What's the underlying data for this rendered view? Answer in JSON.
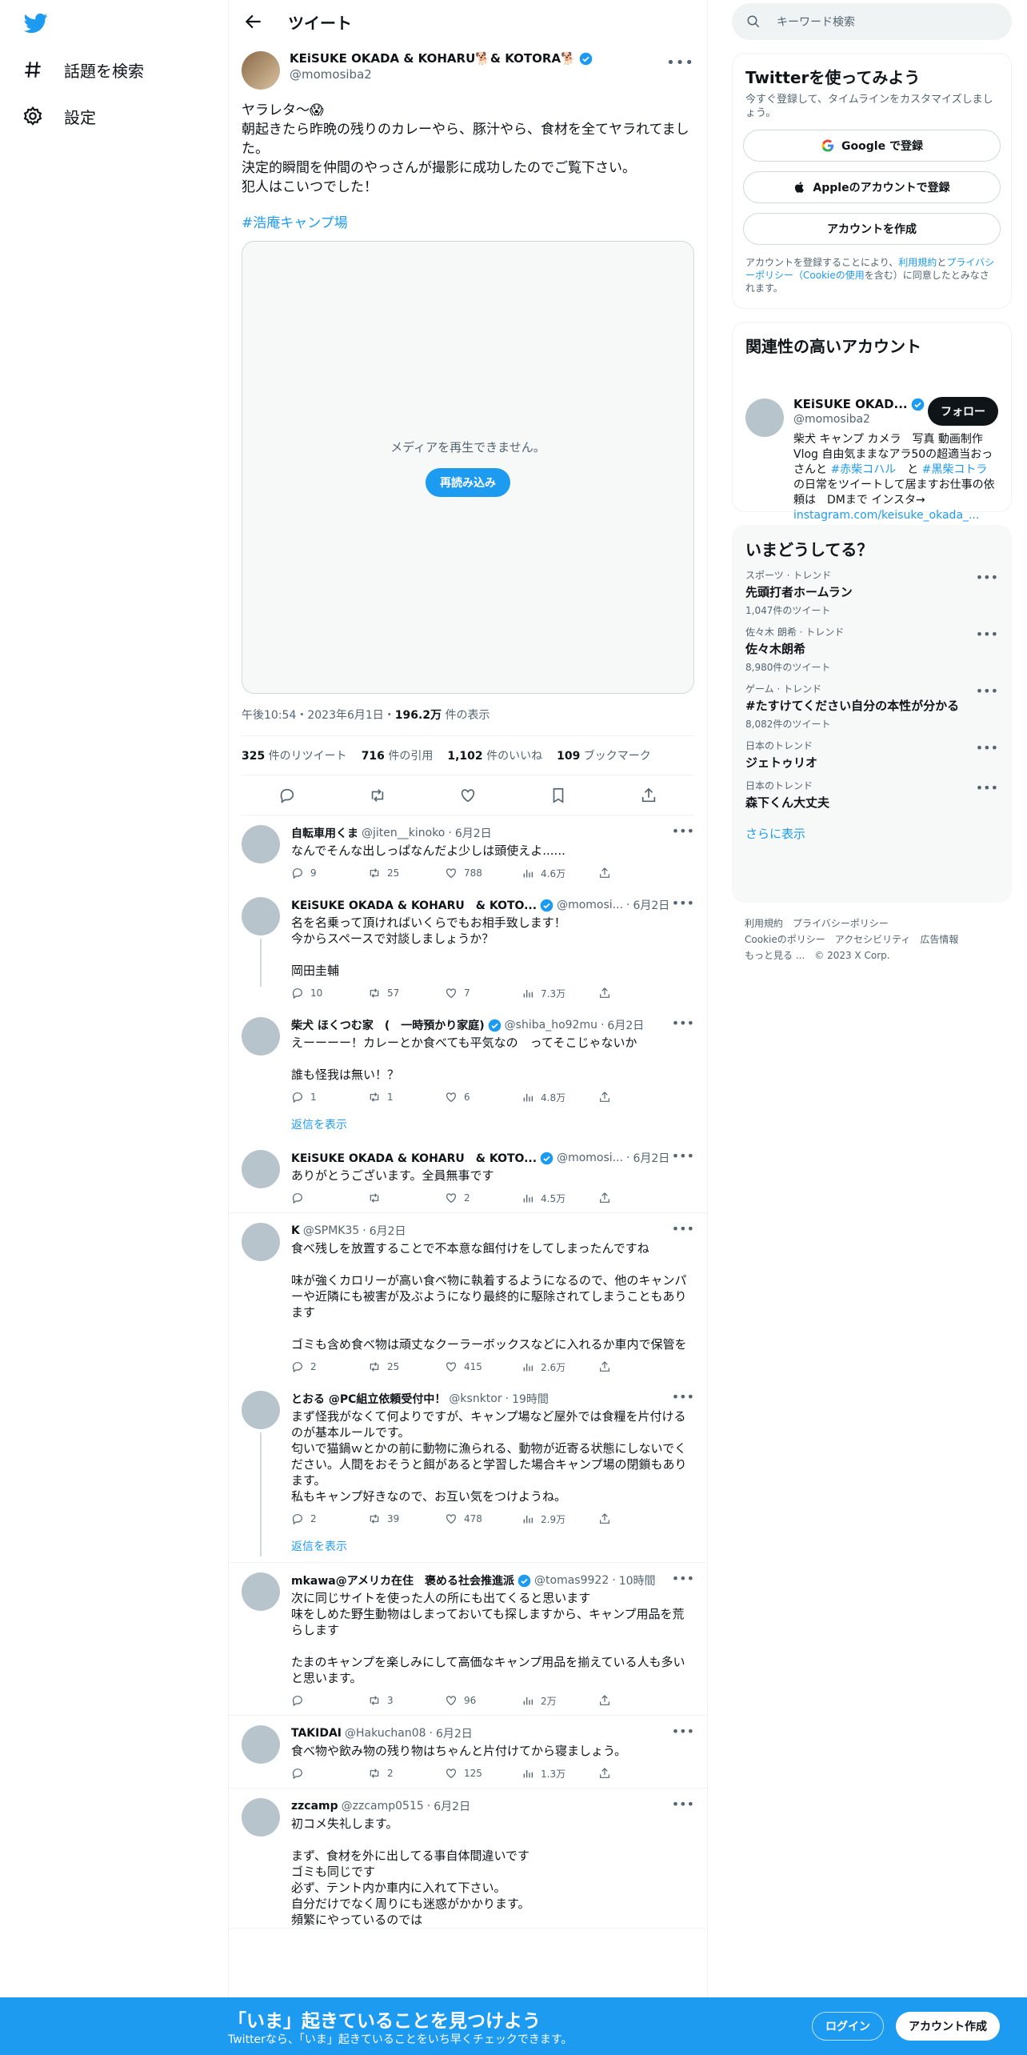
{
  "colors": {
    "accent": "#1d9bf0",
    "text": "#0f1419",
    "muted": "#536471",
    "border": "#eff3f4"
  },
  "nav": {
    "logo_icon": "twitter-bird-icon",
    "items": [
      {
        "label": "話題を検索",
        "icon": "hashtag-icon"
      },
      {
        "label": "設定",
        "icon": "gear-icon"
      }
    ]
  },
  "header": {
    "title": "ツイート"
  },
  "tweet": {
    "display_name": "KEiSUKE OKADA & KOHARU🐕& KOTORA🐕",
    "handle": "@momosiba2",
    "text": "ヤラレタ〜😱\n朝起きたら昨晩の残りのカレーやら、豚汁やら、食材を全てヤラれてました。\n決定的瞬間を仲間のやっさんが撮影に成功したのでご覧下さい。\n犯人はこいつでした！",
    "hashtag": "#浩庵キャンプ場",
    "media_message": "メディアを再生できません。",
    "reload_label": "再読み込み",
    "timestamp": "午後10:54・2023年6月1日・",
    "views": "196.2万",
    "views_label": " 件の表示",
    "stats": [
      {
        "value": "325",
        "label": " 件のリツイート"
      },
      {
        "value": "716",
        "label": " 件の引用"
      },
      {
        "value": "1,102",
        "label": " 件のいいね"
      },
      {
        "value": "109",
        "label": " ブックマーク"
      }
    ]
  },
  "replies": [
    {
      "name": "自転車用くま",
      "handle": "@jiten__kinoko",
      "date": "6月2日",
      "verified": false,
      "text": "なんでそんな出しっぱなんだよ少しは頭使えよ......",
      "replies": "9",
      "retweets": "25",
      "likes": "788",
      "views": "4.6万"
    },
    {
      "name": "KEiSUKE OKADA & KOHARU　& KOTO...",
      "handle": "@momosi...",
      "date": "6月2日",
      "verified": true,
      "text": "名を名乗って頂ければいくらでもお相手致します！\n今からスペースで対談しましょうか？\n\n岡田圭輔",
      "replies": "10",
      "retweets": "57",
      "likes": "7",
      "views": "7.3万"
    },
    {
      "name": "柴犬 ほくつむ家　(　一時預かり家庭)",
      "handle": "@shiba_ho92mu",
      "date": "6月2日",
      "verified": true,
      "text": "えーーーー！カレーとか食べても平気なの　ってそこじゃないか\n\n誰も怪我は無い！？",
      "replies": "1",
      "retweets": "1",
      "likes": "6",
      "views": "4.8万"
    },
    {
      "name": "KEiSUKE OKADA & KOHARU　& KOTO...",
      "handle": "@momosi...",
      "date": "6月2日",
      "verified": true,
      "text": "ありがとうございます。全員無事です",
      "replies": "",
      "retweets": "",
      "likes": "2",
      "views": "4.5万"
    },
    {
      "name": "K",
      "handle": "@SPMK35",
      "date": "6月2日",
      "verified": false,
      "text": "食べ残しを放置することで不本意な餌付けをしてしまったんですね\n\n味が強くカロリーが高い食べ物に執着するようになるので、他のキャンパーや近隣にも被害が及ぶようになり最終的に駆除されてしまうこともあります\n\nゴミも含め食べ物は頑丈なクーラーボックスなどに入れるか車内で保管を",
      "replies": "2",
      "retweets": "25",
      "likes": "415",
      "views": "2.6万"
    },
    {
      "name": "とおる @PC組立依頼受付中！",
      "handle": "@ksnktor",
      "date": "19時間",
      "verified": false,
      "text": "まず怪我がなくて何よりですが、キャンプ場など屋外では食糧を片付けるのが基本ルールです。\n匂いで猫鍋ｗとかの前に動物に漁られる、動物が近寄る状態にしないでください。人間をおそうと餌があると学習した場合キャンプ場の閉鎖もあります。\n私もキャンプ好きなので、お互い気をつけようね。",
      "replies": "2",
      "retweets": "39",
      "likes": "478",
      "views": "2.9万"
    },
    {
      "name": "mkawa@アメリカ在住　褒める社会推進派",
      "handle": "@tomas9922",
      "date": "10時間",
      "verified": true,
      "text": "次に同じサイトを使った人の所にも出てくると思います\n味をしめた野生動物はしまっておいても探しますから、キャンプ用品を荒らします\n\nたまのキャンプを楽しみにして高価なキャンプ用品を揃えている人も多いと思います。",
      "replies": "",
      "retweets": "3",
      "likes": "96",
      "views": "2万"
    },
    {
      "name": "TAKIDAI",
      "handle": "@Hakuchan08",
      "date": "6月2日",
      "verified": false,
      "text": "食べ物や飲み物の残り物はちゃんと片付けてから寝ましょう。",
      "replies": "",
      "retweets": "2",
      "likes": "125",
      "views": "1.3万"
    },
    {
      "name": "zzcamp",
      "handle": "@zzcamp0515",
      "date": "6月2日",
      "verified": false,
      "text": "初コメ失礼します。\n\nまず、食材を外に出してる事自体間違いです\nゴミも同じです\n必ず、テント内か車内に入れて下さい。\n自分だけでなく周りにも迷惑がかかります。\n頻繁にやっているのでは",
      "replies": "",
      "retweets": "",
      "likes": "",
      "views": ""
    }
  ],
  "show_replies_label": "返信を表示",
  "sidebar": {
    "search_placeholder": "キーワード検索",
    "signup": {
      "title": "Twitterを使ってみよう",
      "subtitle": "今すぐ登録して、タイムラインをカスタマイズしましょう。",
      "google": "Google で登録",
      "apple": "Appleのアカウントで登録",
      "create": "アカウントを作成",
      "terms_pre": "アカウントを登録することにより、",
      "terms_link1": "利用規約",
      "terms_mid": "と",
      "terms_link2": "プライバシーポリシー（Cookieの使用",
      "terms_post": "を含む）に同意したとみなされます。"
    },
    "related": {
      "title": "関連性の高いアカウント",
      "name": "KEiSUKE OKAD...",
      "handle": "@momosiba2",
      "follow": "フォロー",
      "bio_1": "柴犬 キャンプ カメラ　写真 動画制作 Vlog 自由気ままなアラ50の超適当おっさんと ",
      "bio_tag1": "#赤柴コハル",
      "bio_2": "　と ",
      "bio_tag2": "#黒柴コトラ",
      "bio_3": "　の日常をツイートして居ますお仕事の依頼は　DMまで インスタ→ ",
      "bio_link": "instagram.com/keisuke_okada_..."
    },
    "trends": {
      "title": "いまどうしてる？",
      "items": [
        {
          "context": "スポーツ · トレンド",
          "name": "先頭打者ホームラン",
          "count": "1,047件のツイート"
        },
        {
          "context": "佐々木 朗希 · トレンド",
          "name": "佐々木朗希",
          "count": "8,980件のツイート"
        },
        {
          "context": "ゲーム · トレンド",
          "name": "#たすけてください自分の本性が分かる",
          "count": "8,082件のツイート"
        },
        {
          "context": "日本のトレンド",
          "name": "ジェトゥリオ",
          "count": ""
        },
        {
          "context": "日本のトレンド",
          "name": "森下くん大丈夫",
          "count": ""
        }
      ],
      "show_more": "さらに表示"
    },
    "footer": [
      "利用規約",
      "プライバシーポリシー",
      "Cookieのポリシー",
      "アクセシビリティ",
      "広告情報",
      "もっと見る ...",
      "© 2023 X Corp."
    ]
  },
  "banner": {
    "title": "「いま」起きていることを見つけよう",
    "subtitle": "Twitterなら、「いま」起きていることをいち早くチェックできます。",
    "login": "ログイン",
    "create": "アカウント作成"
  }
}
